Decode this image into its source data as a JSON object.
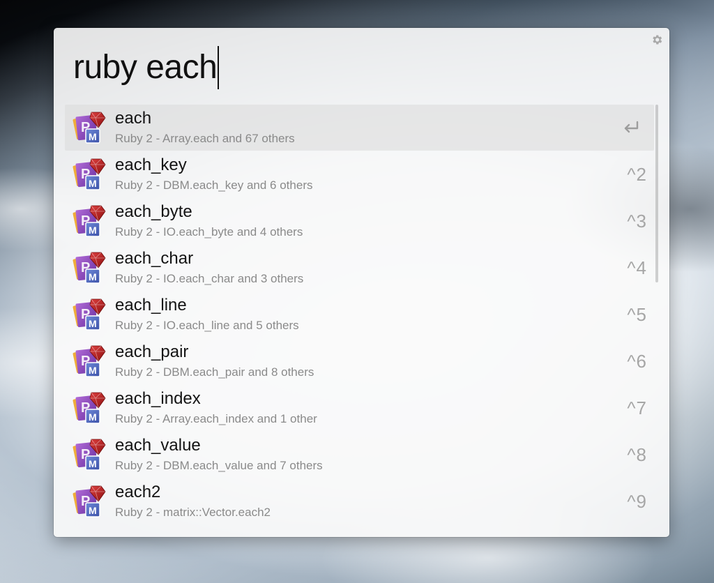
{
  "search": {
    "query": "ruby each"
  },
  "results": [
    {
      "title": "each",
      "subtitle": "Ruby 2 - Array.each and 67 others",
      "shortcut": ""
    },
    {
      "title": "each_key",
      "subtitle": "Ruby 2 - DBM.each_key and 6 others",
      "shortcut": "^2"
    },
    {
      "title": "each_byte",
      "subtitle": "Ruby 2 - IO.each_byte and 4 others",
      "shortcut": "^3"
    },
    {
      "title": "each_char",
      "subtitle": "Ruby 2 - IO.each_char and 3 others",
      "shortcut": "^4"
    },
    {
      "title": "each_line",
      "subtitle": "Ruby 2 - IO.each_line and 5 others",
      "shortcut": "^5"
    },
    {
      "title": "each_pair",
      "subtitle": "Ruby 2 - DBM.each_pair and 8 others",
      "shortcut": "^6"
    },
    {
      "title": "each_index",
      "subtitle": "Ruby 2 - Array.each_index and 1 other",
      "shortcut": "^7"
    },
    {
      "title": "each_value",
      "subtitle": "Ruby 2 - DBM.each_value and 7 others",
      "shortcut": "^8"
    },
    {
      "title": "each2",
      "subtitle": "Ruby 2 - matrix::Vector.each2",
      "shortcut": "^9"
    }
  ],
  "icons": {
    "settings": "gear-icon",
    "result_app": "ruby-docs-app-icon",
    "selected_action": "return-key-icon"
  },
  "colors": {
    "panel_background": "#fafafa",
    "selected_row": "#dcdcdc",
    "title_text": "#141414",
    "subtitle_text": "#8a8a8a",
    "shortcut_text": "#a6a6a6"
  }
}
